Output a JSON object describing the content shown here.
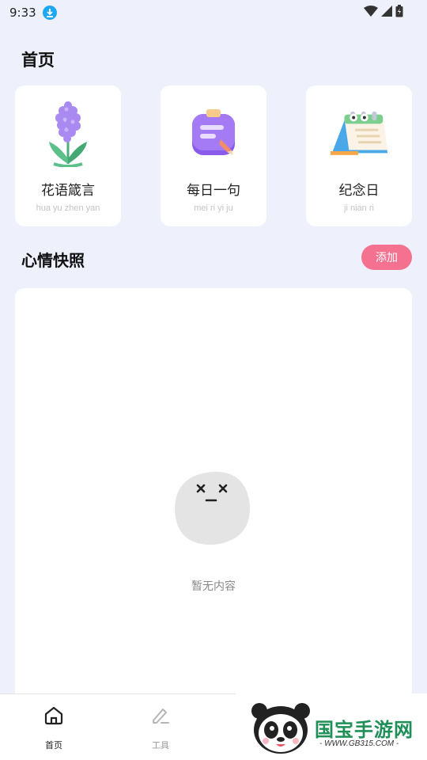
{
  "status_bar": {
    "time": "9:33"
  },
  "page_title": "首页",
  "cards": [
    {
      "title": "花语箴言",
      "subtitle": "hua yu zhen yan",
      "icon": "hyacinth-flower-icon"
    },
    {
      "title": "每日一句",
      "subtitle": "mei ri yi ju",
      "icon": "notepad-pencil-icon"
    },
    {
      "title": "纪念日",
      "subtitle": "ji nian ri",
      "icon": "desk-calendar-icon"
    }
  ],
  "mood_section": {
    "title": "心情快照",
    "add_label": "添加",
    "empty_text": "暂无内容"
  },
  "bottom_nav": {
    "items": [
      {
        "label": "首页",
        "icon": "home-icon"
      },
      {
        "label": "工具",
        "icon": "edit-icon"
      }
    ]
  },
  "watermark": {
    "text": "国宝手游网",
    "url": "- WWW.GB315.COM -"
  },
  "colors": {
    "accent_pink": "#f4718f",
    "background": "#eef0fb",
    "download_blue": "#1fa7f2"
  }
}
